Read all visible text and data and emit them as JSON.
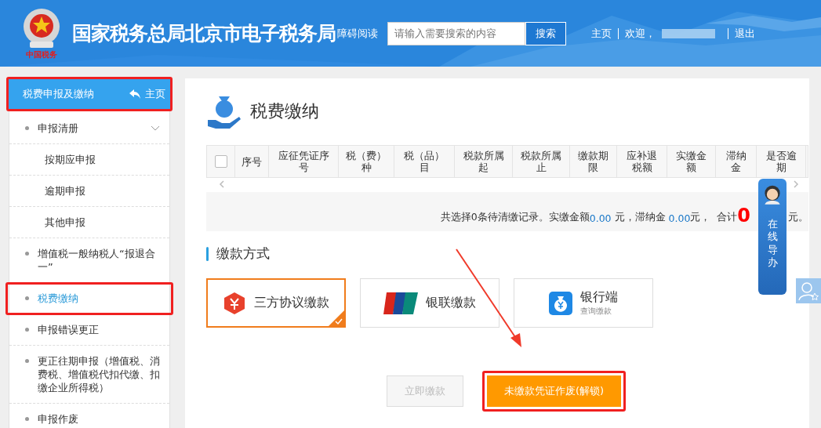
{
  "header": {
    "logo_caption": "中国税务",
    "site_title": "国家税务总局北京市电子税务局",
    "accessibility_link": "障碍阅读",
    "search": {
      "placeholder": "请输入需要搜索的内容",
      "button": "搜索"
    },
    "nav": {
      "home": "主页",
      "welcome": "欢迎，",
      "logout": "退出"
    }
  },
  "sidebar": {
    "title": "税费申报及缴纳",
    "home_link": "主页",
    "highlighted": true,
    "items": [
      {
        "label": "申报清册",
        "selected": false,
        "expanded": true,
        "children": [
          {
            "label": "按期应申报",
            "selected": false
          },
          {
            "label": "逾期申报",
            "selected": false
          },
          {
            "label": "其他申报",
            "selected": false
          }
        ]
      },
      {
        "label": "增值税一般纳税人“报退合一”",
        "selected": false
      },
      {
        "label": "税费缴纳",
        "selected": true
      },
      {
        "label": "申报错误更正",
        "selected": false
      },
      {
        "label": "更正往期申报（增值税、消费税、增值税代扣代缴、扣缴企业所得税）",
        "selected": false
      },
      {
        "label": "申报作废",
        "selected": false
      }
    ]
  },
  "page": {
    "title": "税费缴纳",
    "table": {
      "select_all": false,
      "columns": [
        "序号",
        "应征凭证序号",
        "税（费）种",
        "税（品）目",
        "税款所属起",
        "税款所属止",
        "缴款期限",
        "应补退税额",
        "实缴金额",
        "滞纳金",
        "是否逾期"
      ]
    },
    "summary": {
      "text": "共选择0条待清缴记录。实缴金额",
      "paid": "0.00",
      "paid_unit": " 元，滞纳金 ",
      "late_fee": "0.00",
      "late_unit": "元，  合计",
      "total": "0",
      "total_unit": "元。"
    },
    "payment_section": {
      "title": "缴款方式",
      "methods": [
        {
          "kind": "tripartite",
          "label": "三方协议缴款",
          "selected": true
        },
        {
          "kind": "unionpay",
          "label": "银联缴款",
          "selected": false
        },
        {
          "kind": "bank",
          "label": "银行端",
          "sublabel": "查询缴款",
          "selected": false
        }
      ]
    },
    "buttons": [
      {
        "label": "立即缴款",
        "disabled": true,
        "highlighted": false
      },
      {
        "label": "未缴款凭证作废(解锁)",
        "disabled": false,
        "highlighted": true
      }
    ]
  },
  "online_help": {
    "label": "在线导办"
  }
}
